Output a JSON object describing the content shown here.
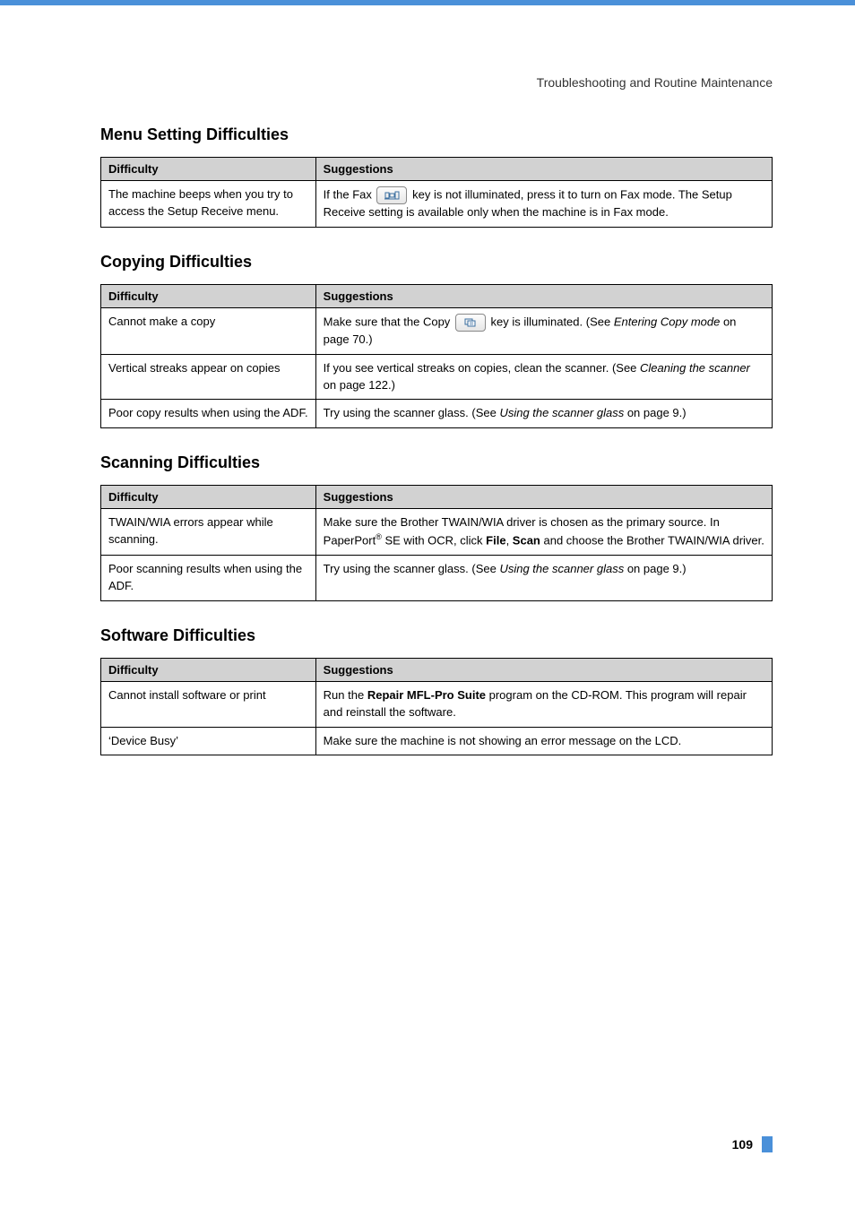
{
  "header": {
    "breadcrumb": "Troubleshooting and Routine Maintenance"
  },
  "sections": {
    "menu": {
      "title": "Menu Setting Difficulties",
      "head_diff": "Difficulty",
      "head_sugg": "Suggestions",
      "row1_diff": "The machine beeps when you try to access the Setup Receive menu.",
      "row1_pre": "If the Fax ",
      "row1_mid": " key is not illuminated, press it to turn on Fax mode. The Setup Receive setting is available only when the machine is in Fax mode."
    },
    "copy": {
      "title": "Copying Difficulties",
      "head_diff": "Difficulty",
      "head_sugg": "Suggestions",
      "r1_diff": "Cannot make a copy",
      "r1_pre": "Make sure that the Copy ",
      "r1_post_a": " key is illuminated. (See ",
      "r1_post_i": "Entering Copy mode",
      "r1_post_b": " on page 70.)",
      "r2_diff": "Vertical streaks appear on copies",
      "r2_sugg_a": "If you see vertical streaks on copies, clean the scanner. (See ",
      "r2_sugg_i": "Cleaning the scanner",
      "r2_sugg_b": " on page 122.)",
      "r3_diff": "Poor copy results when using the ADF.",
      "r3_sugg_a": "Try using the scanner glass. (See ",
      "r3_sugg_i": "Using the scanner glass",
      "r3_sugg_b": " on page 9.)"
    },
    "scan": {
      "title": "Scanning Difficulties",
      "head_diff": "Difficulty",
      "head_sugg": "Suggestions",
      "r1_diff": "TWAIN/WIA errors appear while scanning.",
      "r1_sugg_a": "Make sure the Brother TWAIN/WIA driver is chosen as the primary source. In PaperPort",
      "r1_sugg_sup": "®",
      "r1_sugg_b": " SE with OCR, click ",
      "r1_sugg_bold1": "File",
      "r1_sugg_c": ", ",
      "r1_sugg_bold2": "Scan",
      "r1_sugg_d": " and choose the Brother TWAIN/WIA driver.",
      "r2_diff": "Poor scanning results when using the ADF.",
      "r2_sugg_a": "Try using the scanner glass. (See ",
      "r2_sugg_i": "Using the scanner glass",
      "r2_sugg_b": " on page 9.)"
    },
    "soft": {
      "title": "Software Difficulties",
      "head_diff": "Difficulty",
      "head_sugg": "Suggestions",
      "r1_diff": "Cannot install software or print",
      "r1_sugg_a": "Run the ",
      "r1_sugg_bold": "Repair MFL-Pro Suite",
      "r1_sugg_b": " program on the CD-ROM. This program will repair and reinstall the software.",
      "r2_diff": "‘Device Busy’",
      "r2_sugg": "Make sure the machine is not showing an error message on the LCD."
    }
  },
  "footer": {
    "page": "109"
  }
}
